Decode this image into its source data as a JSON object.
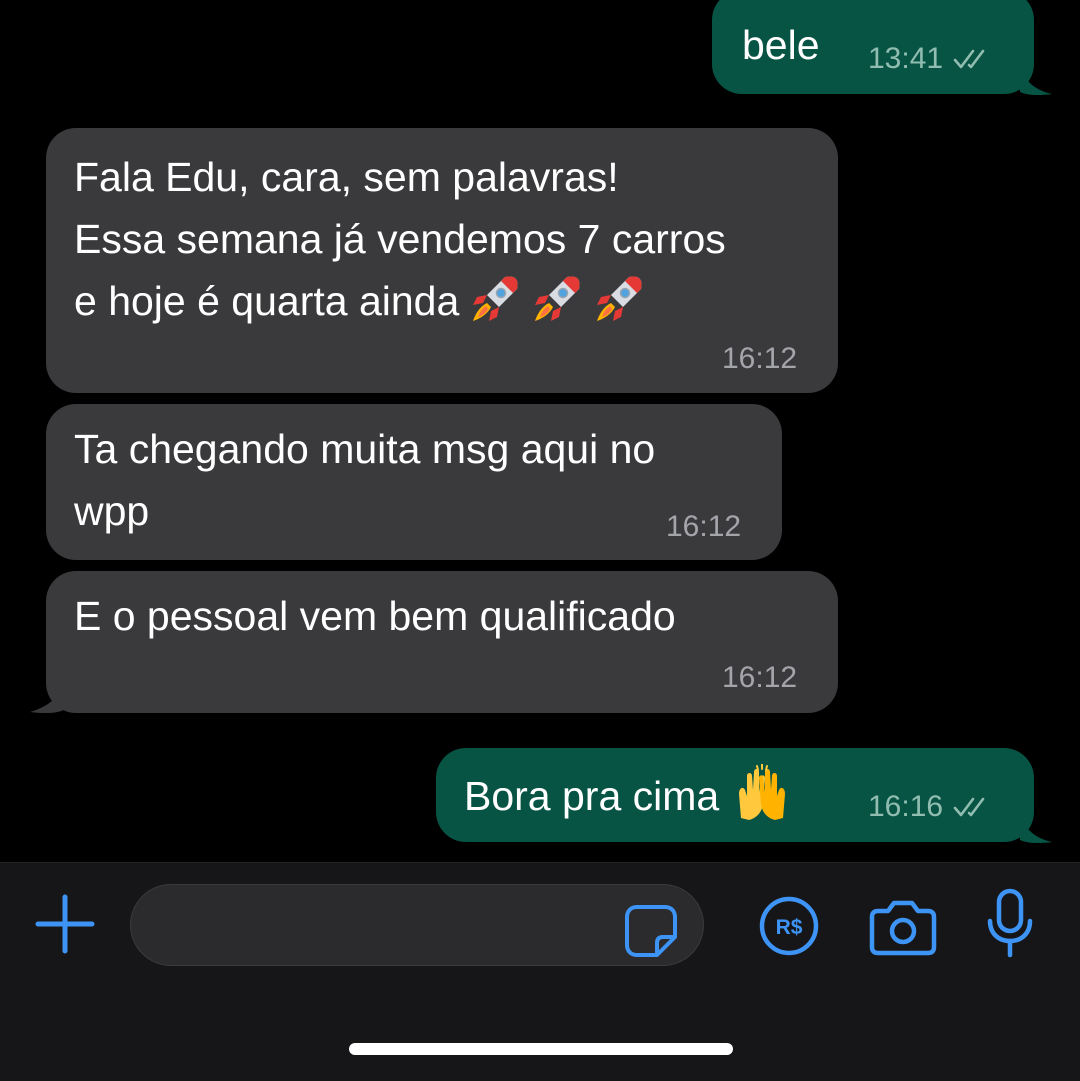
{
  "messages": [
    {
      "direction": "outgoing",
      "text": "bele",
      "time": "13:41",
      "status": "read-ticks"
    },
    {
      "direction": "incoming",
      "text": "Fala Edu, cara, sem palavras!\nEssa semana já vendemos 7 carros\ne hoje é quarta ainda",
      "emoji": "rocket-emoji x3",
      "time": "16:12"
    },
    {
      "direction": "incoming",
      "text": "Ta chegando muita msg aqui no\nwpp",
      "time": "16:12"
    },
    {
      "direction": "incoming",
      "text": "E o pessoal vem bem qualificado",
      "time": "16:12"
    },
    {
      "direction": "outgoing",
      "text": "Bora pra cima",
      "emoji": "raising-hands-emoji",
      "time": "16:16",
      "status": "read-ticks"
    }
  ],
  "composer": {
    "message_input_value": "",
    "icons": [
      "plus-icon",
      "sticker-icon",
      "brl-payment-icon",
      "camera-icon",
      "microphone-icon"
    ]
  },
  "colors": {
    "background": "#000000",
    "incoming_bubble": "#3a3a3c",
    "outgoing_bubble": "#075444",
    "accent": "#3e94f5",
    "composer_bar": "#161618"
  }
}
